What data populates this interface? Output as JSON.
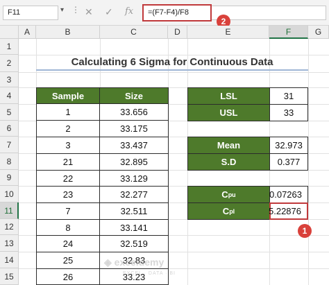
{
  "formula_bar": {
    "name_box": "F11",
    "cancel_icon": "✕",
    "enter_icon": "✓",
    "fx_icon": "fx",
    "formula": "=(F7-F4)/F8"
  },
  "badges": {
    "formula": "2",
    "cell": "1"
  },
  "columns": [
    "A",
    "B",
    "C",
    "D",
    "E",
    "F",
    "G"
  ],
  "rows": [
    "1",
    "2",
    "3",
    "4",
    "5",
    "6",
    "7",
    "8",
    "9",
    "10",
    "11",
    "12",
    "13",
    "14",
    "15"
  ],
  "title": "Calculating 6 Sigma for Continuous Data",
  "sample_table": {
    "headers": [
      "Sample",
      "Size"
    ],
    "rows": [
      [
        "1",
        "33.656"
      ],
      [
        "2",
        "33.175"
      ],
      [
        "3",
        "33.437"
      ],
      [
        "21",
        "32.895"
      ],
      [
        "22",
        "33.129"
      ],
      [
        "23",
        "32.277"
      ],
      [
        "7",
        "32.511"
      ],
      [
        "8",
        "33.141"
      ],
      [
        "24",
        "32.519"
      ],
      [
        "25",
        "32.83"
      ],
      [
        "26",
        "33.23"
      ]
    ]
  },
  "limits": {
    "lsl_label": "LSL",
    "lsl_value": "31",
    "usl_label": "USL",
    "usl_value": "33"
  },
  "stats": {
    "mean_label": "Mean",
    "mean_value": "32.973",
    "sd_label": "S.D",
    "sd_value": "0.377"
  },
  "capability": {
    "cpu_label": "C",
    "cpu_sub": "pu",
    "cpu_value": "0.07263",
    "cpl_label": "C",
    "cpl_sub": "pl",
    "cpl_value": "5.22876"
  },
  "watermark": {
    "brand": "exceldemy",
    "tagline": "EXCEL · DATA · BI"
  }
}
